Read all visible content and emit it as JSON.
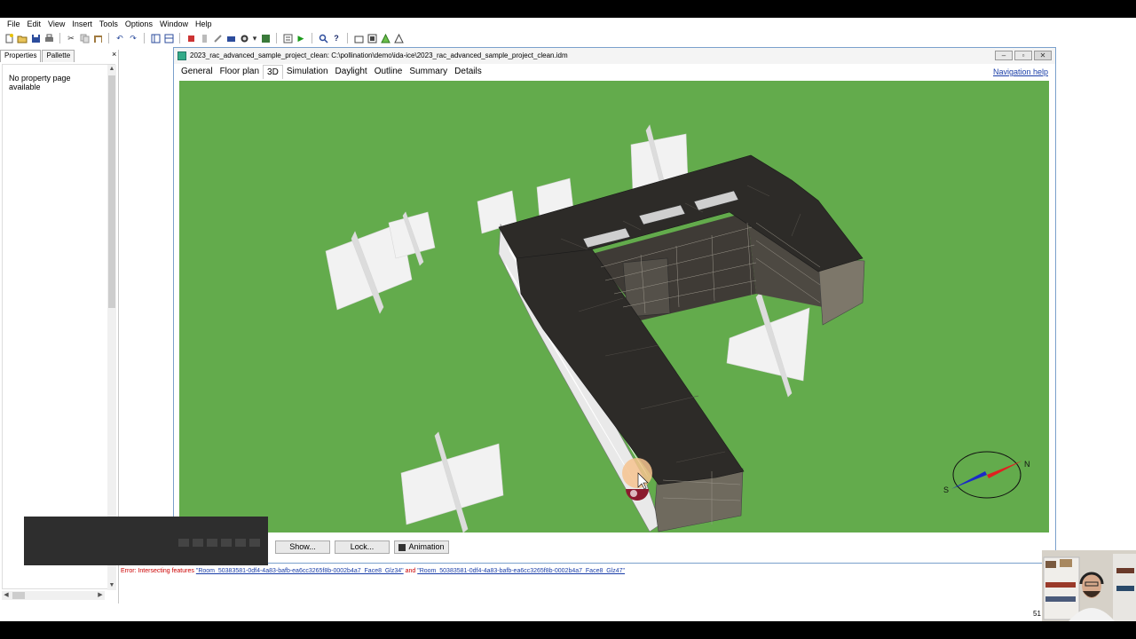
{
  "menu": [
    "File",
    "Edit",
    "View",
    "Insert",
    "Tools",
    "Options",
    "Window",
    "Help"
  ],
  "toolbar_icons": [
    "new-icon",
    "open-icon",
    "save-icon",
    "print-icon",
    "cut-icon",
    "copy-icon",
    "paste-icon",
    "undo-icon",
    "redo-icon",
    "layout-icon",
    "split-icon",
    "tool-icon",
    "tool2-icon",
    "tool3-icon",
    "tool4-icon",
    "tool5-icon",
    "check-icon",
    "run-icon",
    "report-icon",
    "help-icon",
    "shape1-icon",
    "shape2-icon",
    "shape3-icon",
    "shape4-icon"
  ],
  "left_panel": {
    "tabs": [
      "Properties",
      "Pallette"
    ],
    "message": "No property page\navailable",
    "close_glyph": "×"
  },
  "document": {
    "title": "2023_rac_advanced_sample_project_clean: C:\\pollination\\demo\\ida-ice\\2023_rac_advanced_sample_project_clean.idm",
    "tabs": [
      "General",
      "Floor plan",
      "3D",
      "Simulation",
      "Daylight",
      "Outline",
      "Summary",
      "Details"
    ],
    "active_tab": "3D",
    "nav_help": "Navigation help",
    "compass": {
      "south": "S",
      "north": "N"
    },
    "buttons": {
      "show": "Show...",
      "lock": "Lock...",
      "animation": "Animation"
    }
  },
  "status": {
    "prefix": "Error: Intersecting features ",
    "link1": "\"Room_50383581-0df4-4a83-bafb-ea6cc3265f8b-0002b4a7_Face8_Glz34\"",
    "middle": " and ",
    "link2": "\"Room_50383581-0df4-4a83-bafb-ea6cc3265f8b-0002b4a7_Face8_Glz47\""
  },
  "page_number": "51",
  "colors": {
    "ground": "#63ab4c",
    "roof": "#2d2b28",
    "facade": "#6f6a5e",
    "error": "#cc0000",
    "link": "#1a3ea8"
  }
}
